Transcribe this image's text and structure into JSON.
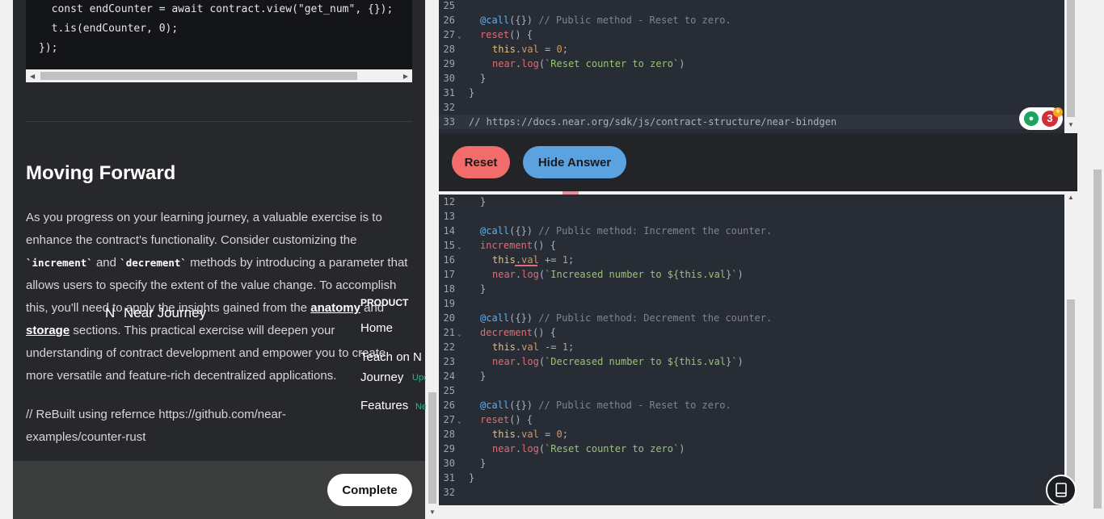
{
  "left": {
    "code_lines": [
      "  const endCounter = await contract.view(\"get_num\", {});",
      "  t.is(endCounter, 0);",
      "});"
    ],
    "heading": "Moving Forward",
    "para": {
      "p1": "As you progress on your learning journey, a valuable exercise is to enhance the contract's functionality. Consider customizing the ",
      "code1": "`increment`",
      "p2": " and ",
      "code2": "`decrement`",
      "p3": " methods by introducing a parameter that allows users to specify the extent of the value change. To accomplish this, you'll need to apply the insights gained from the ",
      "link1": "anatomy",
      "p4": " and ",
      "link2": "storage",
      "p5": " sections. This practical exercise will deepen your understanding of contract development and empower you to create more versatile and feature-rich decentralized applications."
    },
    "note": "// ReBuilt using refernce https://github.com/near-examples/counter-rust",
    "complete_label": "Complete"
  },
  "overlay_nav": {
    "brand": "Near Journey",
    "brand_mark": "N",
    "section": "PRODUCT",
    "home": "Home",
    "teach": "Teach on N",
    "journey": "Journey",
    "journey_tag": "Upco",
    "features": "Features",
    "features_tag": "New"
  },
  "editor_top": {
    "lines": [
      {
        "n": "25",
        "fold": false
      },
      {
        "n": "26",
        "fold": false
      },
      {
        "n": "27",
        "fold": true
      },
      {
        "n": "28",
        "fold": false
      },
      {
        "n": "29",
        "fold": false
      },
      {
        "n": "30",
        "fold": false
      },
      {
        "n": "31",
        "fold": false
      },
      {
        "n": "32",
        "fold": false
      },
      {
        "n": "33",
        "fold": false
      }
    ],
    "comment_url": "// https://docs.near.org/sdk/js/contract-structure/near-bindgen",
    "badge_count": "3"
  },
  "buttons": {
    "reset": "Reset",
    "hide_answer": "Hide Answer"
  },
  "editor_bottom": {
    "line_numbers": [
      "12",
      "13",
      "14",
      "15",
      "16",
      "17",
      "18",
      "19",
      "20",
      "21",
      "22",
      "23",
      "24",
      "25",
      "26",
      "27",
      "28",
      "29",
      "30",
      "31",
      "32"
    ],
    "comments": {
      "increment": "// Public method: Increment the counter.",
      "decrement": "// Public method: Decrement the counter.",
      "reset": "// Public method - Reset to zero."
    },
    "logs": {
      "increment": "`Increased number to ${this.val}`",
      "decrement": "`Decreased number to ${this.val}`",
      "reset": "`Reset counter to zero`"
    }
  },
  "colors": {
    "reset_button": "#f26c6c",
    "hide_button": "#5aa2e0",
    "editor_bg": "#282c34"
  }
}
